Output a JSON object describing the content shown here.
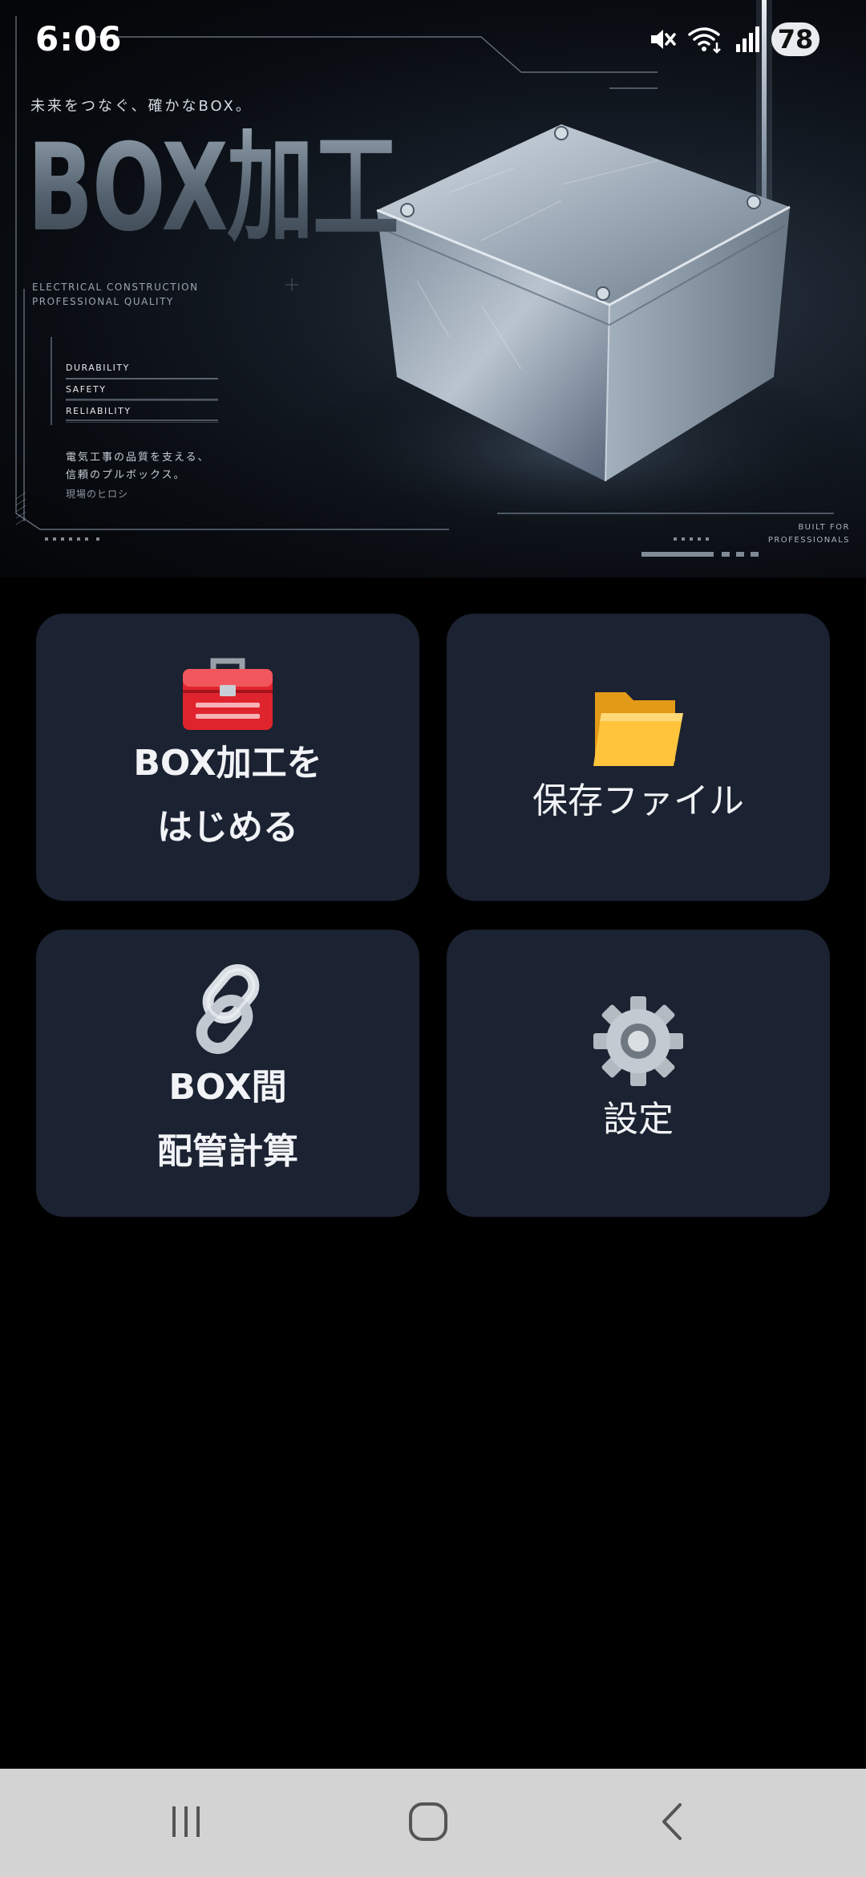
{
  "status_bar": {
    "time": "6:06",
    "battery": "78",
    "icons": [
      "mute-icon",
      "wifi-icon",
      "signal-icon",
      "battery-icon"
    ]
  },
  "hero": {
    "tagline": "未来をつなぐ、確かなBOX。",
    "title": "BOX加工",
    "subtitle_lines": [
      "ELECTRICAL CONSTRUCTION",
      "PROFESSIONAL QUALITY"
    ],
    "features": [
      "DURABILITY",
      "SAFETY",
      "RELIABILITY"
    ],
    "description_lines": [
      "電気工事の品質を支える、",
      "信頼のプルボックス。"
    ],
    "signature": "現場のヒロシ",
    "built_lines": [
      "BUILT FOR",
      "PROFESSIONALS"
    ]
  },
  "menu": {
    "start": {
      "label": "BOX加工を\nはじめる",
      "icon": "toolbox-icon"
    },
    "files": {
      "label": "保存ファイル",
      "icon": "folder-icon"
    },
    "pipe": {
      "label": "BOX間\n配管計算",
      "icon": "chain-link-icon"
    },
    "settings": {
      "label": "設定",
      "icon": "gear-icon"
    }
  },
  "colors": {
    "background": "#000000",
    "tile": "#1b2231",
    "tile_text": "#f1f3f6",
    "navbar": "#d3d3d3"
  },
  "nav": {
    "buttons": [
      "recents-icon",
      "home-icon",
      "back-icon"
    ]
  }
}
